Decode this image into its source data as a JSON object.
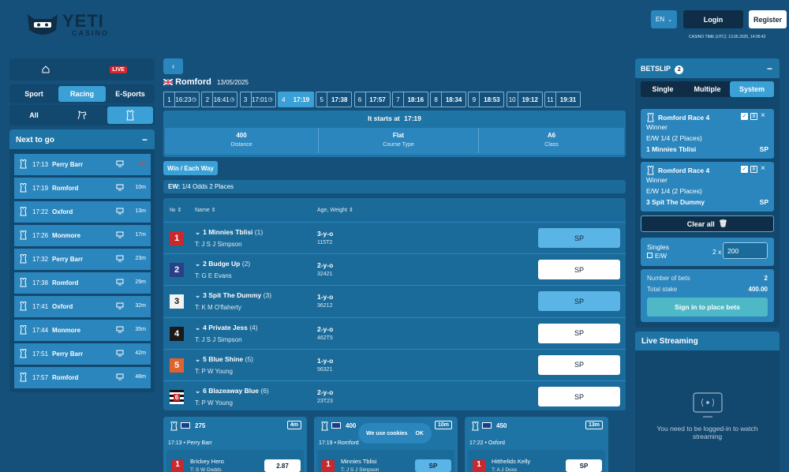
{
  "header": {
    "logo_text": "YETI",
    "logo_sub": "CASINO",
    "lang": "EN",
    "login": "Login",
    "register": "Register",
    "casino_time": "CASINO TIME (UTC): 13.05.2025, 14:06:42"
  },
  "leftnav": {
    "live_badge": "LIVE",
    "tabs": [
      "Sport",
      "Racing",
      "E-Sports"
    ],
    "sub_tabs": [
      "All"
    ],
    "next_to_go": {
      "title": "Next to go",
      "collapse": "−",
      "races": [
        {
          "time": "17:13",
          "venue": "Perry Barr",
          "eta": "1m"
        },
        {
          "time": "17:19",
          "venue": "Romford",
          "eta": "10m"
        },
        {
          "time": "17:22",
          "venue": "Oxford",
          "eta": "13m"
        },
        {
          "time": "17:26",
          "venue": "Monmore",
          "eta": "17m"
        },
        {
          "time": "17:32",
          "venue": "Perry Barr",
          "eta": "23m"
        },
        {
          "time": "17:38",
          "venue": "Romford",
          "eta": "29m"
        },
        {
          "time": "17:41",
          "venue": "Oxford",
          "eta": "32m"
        },
        {
          "time": "17:44",
          "venue": "Monmore",
          "eta": "35m"
        },
        {
          "time": "17:51",
          "venue": "Perry Barr",
          "eta": "42m"
        },
        {
          "time": "17:57",
          "venue": "Romford",
          "eta": "48m"
        }
      ]
    }
  },
  "race": {
    "venue": "Romford",
    "date": "13/05/2025",
    "times": [
      {
        "n": "1",
        "t": "16:23"
      },
      {
        "n": "2",
        "t": "16:41"
      },
      {
        "n": "3",
        "t": "17:01"
      },
      {
        "n": "4",
        "t": "17:19"
      },
      {
        "n": "5",
        "t": "17:38"
      },
      {
        "n": "6",
        "t": "17:57"
      },
      {
        "n": "7",
        "t": "18:16"
      },
      {
        "n": "8",
        "t": "18:34"
      },
      {
        "n": "9",
        "t": "18:53"
      },
      {
        "n": "10",
        "t": "19:12"
      },
      {
        "n": "11",
        "t": "19:31"
      }
    ],
    "starts_label": "It starts at",
    "starts_time": "17:19",
    "info": [
      {
        "v": "400",
        "l": "Distance"
      },
      {
        "v": "Flat",
        "l": "Course Type"
      },
      {
        "v": "A6",
        "l": "Class"
      }
    ],
    "market_tab": "Win / Each Way",
    "ew_label": "EW:",
    "ew_text": "1/4 Odds 2 Places",
    "cols": {
      "no": "№",
      "name": "Name",
      "age": "Age, Weight"
    },
    "runners": [
      {
        "no": "1",
        "name": "1 Minnies Tblisi",
        "form_no": "(1)",
        "trainer": "T: J S J Simpson",
        "age": "3-y-o",
        "form": "115T2",
        "price": "SP",
        "selected": true,
        "color": "#c8282e",
        "fg": "#fff"
      },
      {
        "no": "2",
        "name": "2 Budge Up",
        "form_no": "(2)",
        "trainer": "T: G E Evans",
        "age": "2-y-o",
        "form": "32421",
        "price": "SP",
        "selected": false,
        "color": "#2a3f8a",
        "fg": "#fff"
      },
      {
        "no": "3",
        "name": "3 Spit The Dummy",
        "form_no": "(3)",
        "trainer": "T: K M O'flaherty",
        "age": "1-y-o",
        "form": "36212",
        "price": "SP",
        "selected": true,
        "color": "#f2f2f2",
        "fg": "#111"
      },
      {
        "no": "4",
        "name": "4 Private Jess",
        "form_no": "(4)",
        "trainer": "T: J S J Simpson",
        "age": "2-y-o",
        "form": "462T5",
        "price": "SP",
        "selected": false,
        "color": "#1a1a1a",
        "fg": "#fff"
      },
      {
        "no": "5",
        "name": "5 Blue Shine",
        "form_no": "(5)",
        "trainer": "T: P W Young",
        "age": "1-y-o",
        "form": "56321",
        "price": "SP",
        "selected": false,
        "color": "#e0622e",
        "fg": "#fff"
      },
      {
        "no": "6",
        "name": "6 Blazeaway Blue",
        "form_no": "(6)",
        "trainer": "T: P W Young",
        "age": "2-y-o",
        "form": "23T23",
        "price": "SP",
        "selected": false,
        "color": "stripe",
        "fg": "#111"
      }
    ]
  },
  "cards": [
    {
      "dist": "275",
      "eta": "4m",
      "time": "17:13 • Perry Barr",
      "runner": "Brickey Hero",
      "trainer": "T: S W Dodds",
      "price": "2.87"
    },
    {
      "dist": "400",
      "eta": "10m",
      "time": "17:19 • Romford",
      "runner": "Minnies Tblisi",
      "trainer": "T: J S J Simpson",
      "price": "SP"
    },
    {
      "dist": "450",
      "eta": "13m",
      "time": "17:22 • Oxford",
      "runner": "Hitthelids Kelly",
      "trainer": "T: A J Doss",
      "price": "SP"
    }
  ],
  "betslip": {
    "title": "BETSLIP",
    "count": "2",
    "collapse": "−",
    "tabs": [
      "Single",
      "Multiple",
      "System"
    ],
    "bets": [
      {
        "race": "Romford Race 4",
        "market": "Winner",
        "ew": "E/W 1/4 (2 Places)",
        "runner": "1 Minnies Tblisi",
        "price": "SP"
      },
      {
        "race": "Romford Race 4",
        "market": "Winner",
        "ew": "E/W 1/4 (2 Places)",
        "runner": "3 Spit The Dummy",
        "price": "SP"
      }
    ],
    "clear": "Clear all",
    "singles": "Singles",
    "ew": "E/W",
    "mult": "2 x",
    "stake": "200",
    "num_bets_label": "Number of bets",
    "num_bets": "2",
    "total_label": "Total stake",
    "total": "400.00",
    "signin": "Sign in to place bets"
  },
  "stream": {
    "title": "Live Streaming",
    "msg": "You need to be logged-in to watch streaming"
  },
  "cookie": {
    "text": "We use cookies",
    "ok": "OK"
  }
}
